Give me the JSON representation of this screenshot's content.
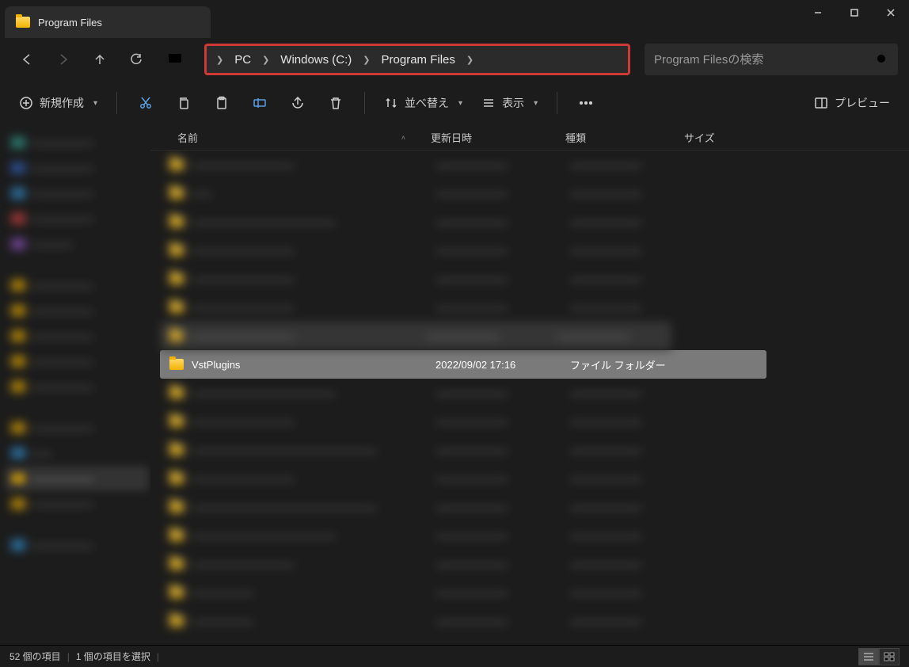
{
  "window": {
    "tab_title": "Program Files"
  },
  "breadcrumb": {
    "items": [
      "PC",
      "Windows (C:)",
      "Program Files"
    ]
  },
  "search": {
    "placeholder": "Program Filesの検索"
  },
  "toolbar": {
    "new_label": "新規作成",
    "sort_label": "並べ替え",
    "view_label": "表示",
    "preview_label": "プレビュー"
  },
  "columns": {
    "name": "名前",
    "date": "更新日時",
    "type": "種類",
    "size": "サイズ"
  },
  "selected_row": {
    "name": "VstPlugins",
    "date": "2022/09/02 17:16",
    "type": "ファイル フォルダー"
  },
  "status": {
    "count_text": "52 個の項目",
    "selection_text": "1 個の項目を選択"
  }
}
